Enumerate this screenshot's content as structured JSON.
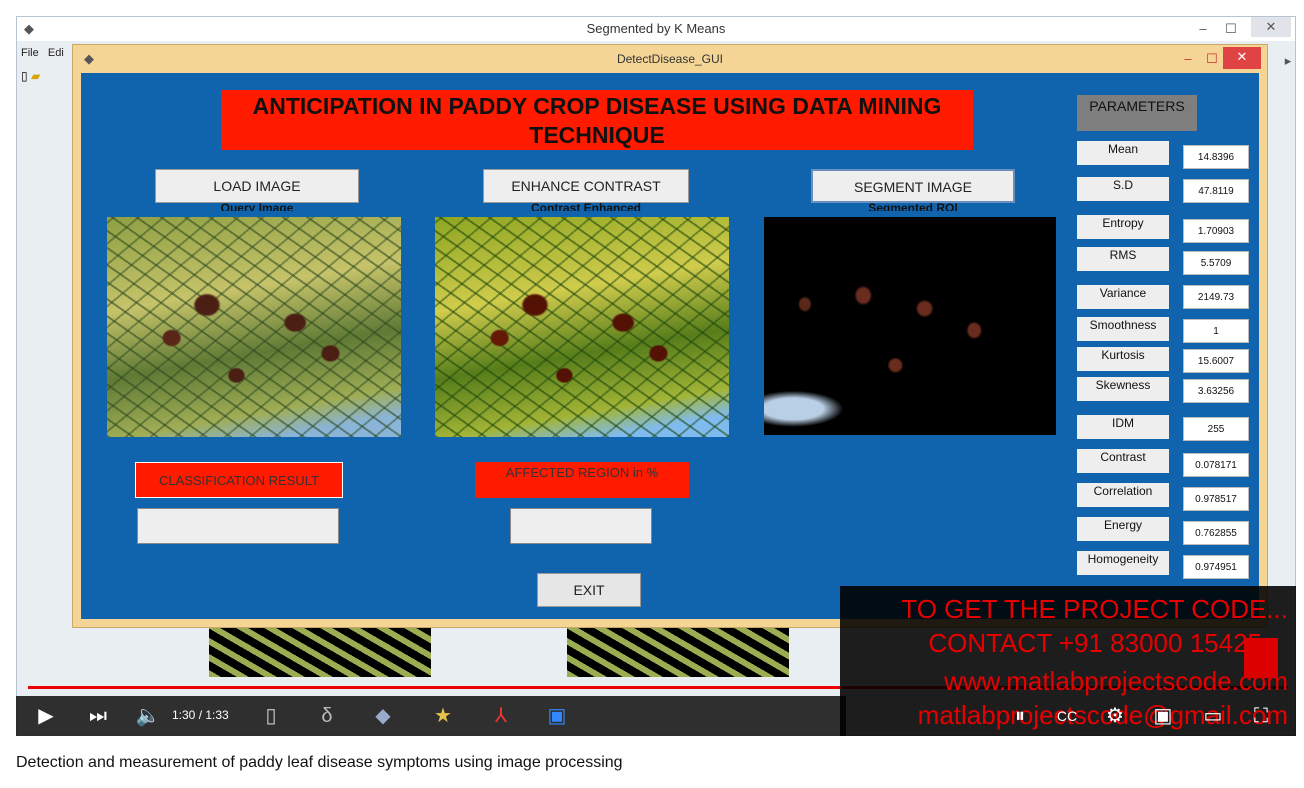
{
  "outer_window": {
    "title": "Segmented by K Means",
    "menu": [
      "File",
      "Edi"
    ]
  },
  "gui": {
    "window_title": "DetectDisease_GUI",
    "app_title": "ANTICIPATION IN PADDY CROP DISEASE USING DATA MINING TECHNIQUE",
    "buttons": {
      "load": "LOAD IMAGE",
      "enhance": "ENHANCE CONTRAST",
      "segment": "SEGMENT IMAGE",
      "exit": "EXIT"
    },
    "captions": {
      "query": "Query Image",
      "contrast": "Contrast Enhanced",
      "segmented": "Segmented ROI"
    },
    "classification_label": "CLASSIFICATION RESULT",
    "affected_label": "AFFECTED REGION in %",
    "parameters_heading": "PARAMETERS",
    "parameters": [
      {
        "label": "Mean",
        "value": "14.8396"
      },
      {
        "label": "S.D",
        "value": "47.8119"
      },
      {
        "label": "Entropy",
        "value": "1.70903"
      },
      {
        "label": "RMS",
        "value": "5.5709"
      },
      {
        "label": "Variance",
        "value": "2149.73"
      },
      {
        "label": "Smoothness",
        "value": "1"
      },
      {
        "label": "Kurtosis",
        "value": "15.6007"
      },
      {
        "label": "Skewness",
        "value": "3.63256"
      },
      {
        "label": "IDM",
        "value": "255"
      },
      {
        "label": "Contrast",
        "value": "0.078171"
      },
      {
        "label": "Correlation",
        "value": "0.978517"
      },
      {
        "label": "Energy",
        "value": "0.762855"
      },
      {
        "label": "Homogeneity",
        "value": "0.974951"
      }
    ]
  },
  "player": {
    "time": "1:30 / 1:33",
    "progress": 0.968,
    "overlay_lines": [
      "TO GET THE PROJECT CODE...",
      "CONTACT +91 83000 15425",
      "www.matlabprojectscode.com",
      "matlabprojectscode@gmail.com"
    ],
    "overlay_color": "#e60000"
  },
  "video_title": "Detection and measurement of paddy leaf disease symptoms using image processing"
}
